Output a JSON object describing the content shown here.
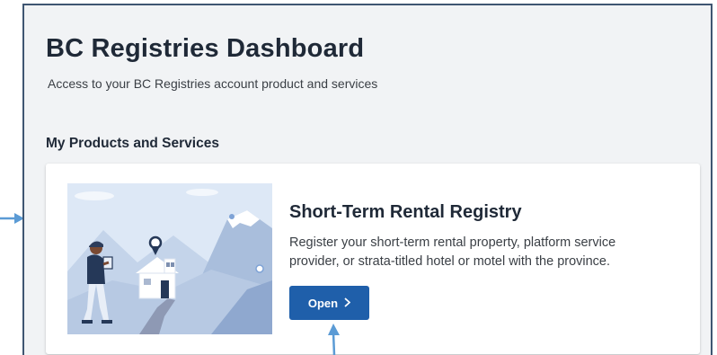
{
  "header": {
    "title": "BC Registries Dashboard",
    "subtitle": "Access to your BC Registries account product and services"
  },
  "products": {
    "section_title": "My Products and Services",
    "items": [
      {
        "title": "Short-Term Rental Registry",
        "description": "Register your short-term rental property, platform service provider, or strata-titled hotel or motel with the province.",
        "button_label": "Open",
        "button_icon": "chevron-right-icon",
        "illustration": "person-house-mountains-illustration"
      }
    ]
  },
  "annotations": {
    "arrow_color": "#5b9bd5",
    "arrows": [
      "arrow-pointing-right",
      "arrow-pointing-up"
    ]
  },
  "colors": {
    "primary_button": "#1f5faa",
    "page_background": "#f1f3f5",
    "frame_border": "#3f5672"
  }
}
